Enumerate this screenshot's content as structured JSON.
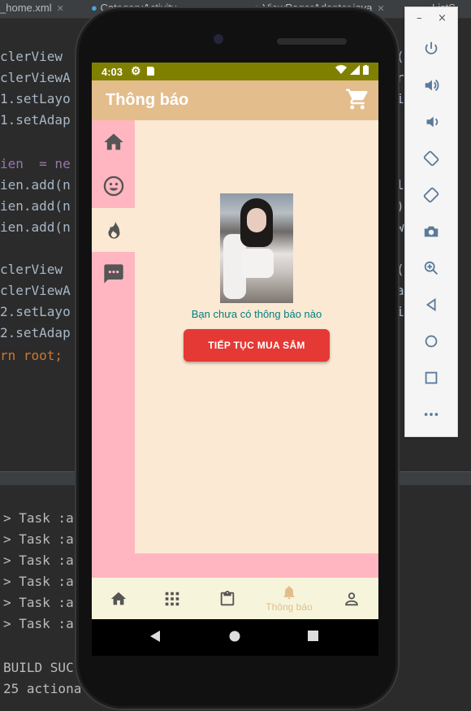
{
  "ide": {
    "tabs": [
      {
        "label": "_home.xml"
      },
      {
        "label": "CategoryActivity"
      },
      {
        "label": "ViewPagerAdapter.java"
      },
      {
        "label": "ListS"
      }
    ],
    "code_left": [
      "clerView",
      "clerViewA",
      "1.setLayo",
      "1.setAdap",
      "",
      "ien  = ne",
      "ien.add(n",
      "ien.add(n",
      "ien.add(n",
      "",
      "clerView",
      "clerViewA",
      "2.setLayo",
      "2.setAdap",
      "rn root;"
    ],
    "code_right": [
      "(Rec",
      "rap",
      "i",
      "",
      "",
      "",
      "le",
      "));",
      "wa",
      "",
      "(Rec",
      "ap",
      "i pa"
    ],
    "run_lines": [
      "> Task :a",
      "> Task :a",
      "> Task :a",
      "> Task :a",
      "> Task :a",
      "> Task :a"
    ],
    "build_line": "BUILD SUC",
    "actionable_line": "25 actiona"
  },
  "emulator": {
    "minimize_label": "–",
    "close_label": "×",
    "buttons": [
      "power-icon",
      "volume-up-icon",
      "volume-down-icon",
      "rotate-left-icon",
      "rotate-right-icon",
      "camera-icon",
      "zoom-icon",
      "back-icon",
      "home-icon",
      "overview-icon",
      "more-icon"
    ]
  },
  "status_bar": {
    "time": "4:03",
    "color": "#808000"
  },
  "app_bar": {
    "title": "Thông báo",
    "color": "#e4bd8c"
  },
  "sidebar": {
    "items": [
      {
        "icon": "home-icon"
      },
      {
        "icon": "smiley-icon"
      },
      {
        "icon": "fire-icon",
        "active": true
      },
      {
        "icon": "chat-icon"
      }
    ],
    "color": "#ffb6c1"
  },
  "content": {
    "empty_message": "Bạn chưa có thông báo nào",
    "continue_button": "TIẾP TỤC MUA SẮM",
    "button_color": "#e53935"
  },
  "bottom_nav": {
    "items": [
      {
        "icon": "home-icon",
        "label": ""
      },
      {
        "icon": "grid-icon",
        "label": ""
      },
      {
        "icon": "clipboard-icon",
        "label": ""
      },
      {
        "icon": "bell-icon",
        "label": "Thông báo",
        "active": true
      },
      {
        "icon": "person-icon",
        "label": ""
      }
    ],
    "active_color": "#e4bd8c"
  }
}
